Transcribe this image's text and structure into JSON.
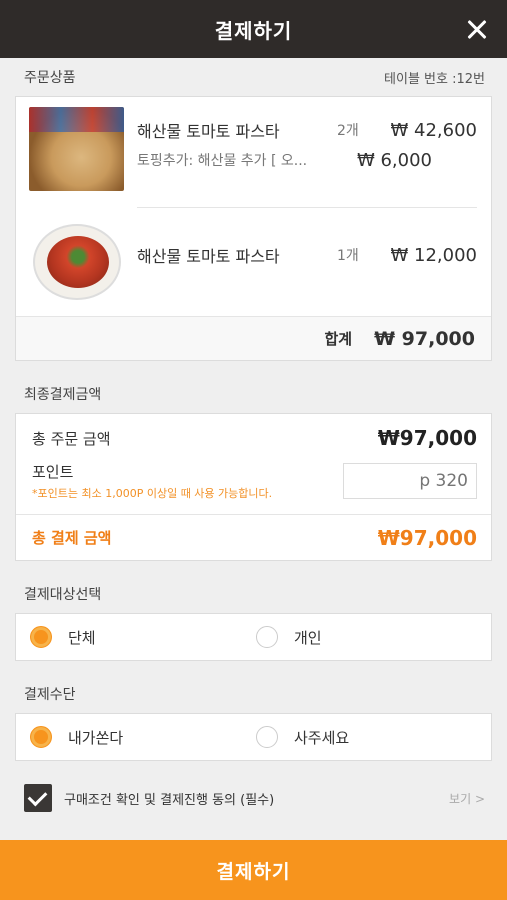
{
  "header": {
    "title": "결제하기"
  },
  "order": {
    "section_title": "주문상품",
    "table_number": "테이블 번호 :12번",
    "items": [
      {
        "name": "해산물 토마토 파스타",
        "qty": "2개",
        "price": "₩ 42,600",
        "topping": "토핑추가: 해산물 추가 [ 오...",
        "topping_price": "₩ 6,000",
        "image": "seafood-pizza"
      },
      {
        "name": "해산물 토마토 파스타",
        "qty": "1개",
        "price": "₩ 12,000",
        "image": "seafood-tomato-pasta"
      }
    ],
    "total_label": "합계",
    "total_value": "₩ 97,000"
  },
  "final_payment": {
    "section_title": "최종결제금액",
    "order_total_label": "총 주문 금액",
    "order_total_value": "₩97,000",
    "point_label": "포인트",
    "point_note": "*포인트는 최소 1,000P 이상일 때 사용 가능합니다.",
    "point_placeholder": "p 320",
    "grand_total_label": "총 결제 금액",
    "grand_total_value": "₩97,000"
  },
  "target": {
    "section_title": "결제대상선택",
    "options": [
      {
        "label": "단체",
        "selected": true
      },
      {
        "label": "개인",
        "selected": false
      }
    ]
  },
  "method": {
    "section_title": "결제수단",
    "options": [
      {
        "label": "내가쏜다",
        "selected": true
      },
      {
        "label": "사주세요",
        "selected": false
      }
    ]
  },
  "agreement": {
    "text": "구매조건 확인 및 결제진행 동의 (필수)",
    "view": "보기 >",
    "checked": true
  },
  "submit": {
    "label": "결제하기"
  },
  "colors": {
    "accent": "#f7941d",
    "header_bg": "#2f2b29",
    "highlight_text": "#f07f18"
  }
}
